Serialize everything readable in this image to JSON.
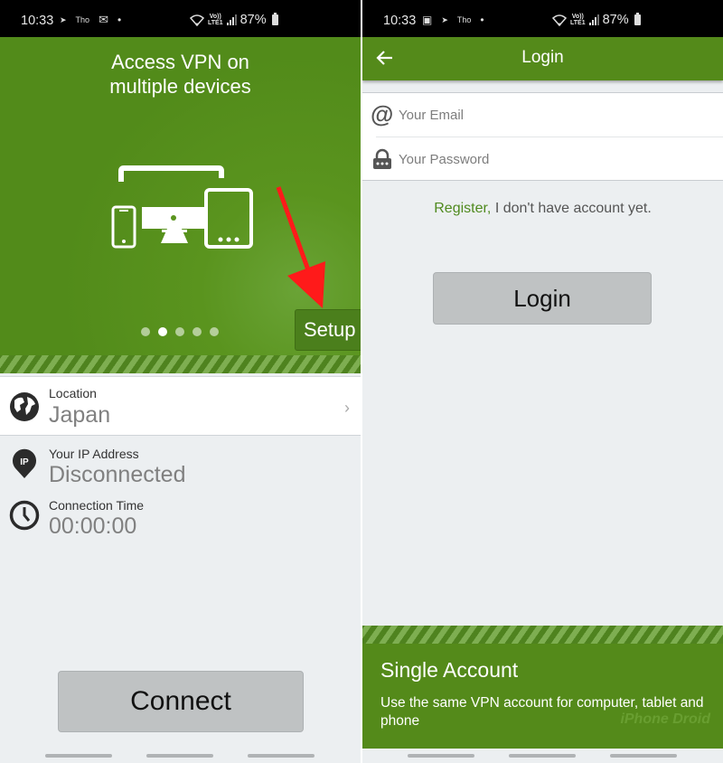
{
  "left": {
    "status": {
      "time": "10:33",
      "battery": "87%"
    },
    "hero": {
      "title_line1": "Access VPN on",
      "title_line2": "multiple devices",
      "carousel_pages": 5,
      "carousel_active_index": 1,
      "setup_label": "Setup"
    },
    "location": {
      "label": "Location",
      "value": "Japan"
    },
    "ip": {
      "label": "Your IP Address",
      "value": "Disconnected",
      "badge": "IP"
    },
    "time": {
      "label": "Connection Time",
      "value": "00:00:00"
    },
    "connect_label": "Connect"
  },
  "right": {
    "status": {
      "time": "10:33",
      "battery": "87%"
    },
    "appbar_title": "Login",
    "email_placeholder": "Your Email",
    "password_placeholder": "Your Password",
    "register_link": "Register,",
    "register_text": " I don't have account yet.",
    "login_label": "Login",
    "promo": {
      "title": "Single Account",
      "text": "Use the same VPN account for computer, tablet and phone"
    },
    "watermark": "iPhone Droid"
  },
  "colors": {
    "brand_green": "#548a1a",
    "link_green": "#4f8a1e",
    "arrow_red": "#ff1a1a"
  }
}
